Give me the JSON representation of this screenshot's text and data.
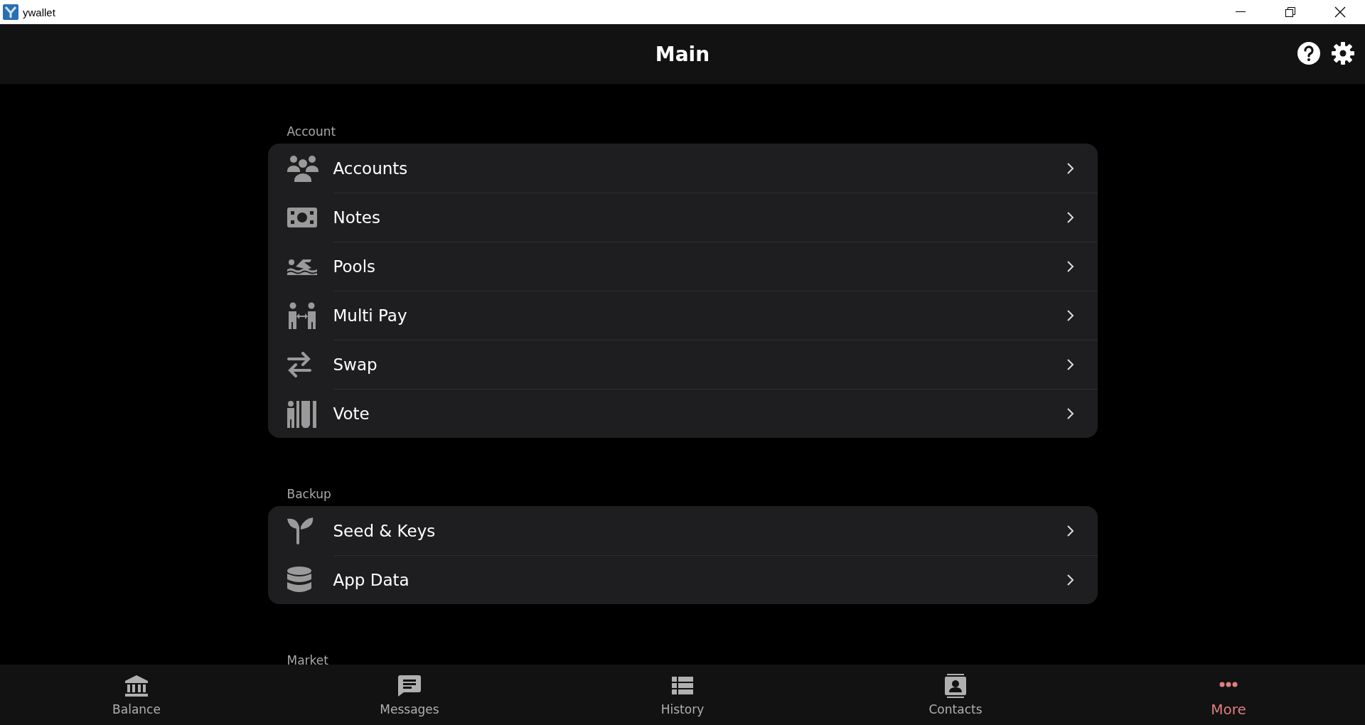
{
  "window": {
    "title": "ywallet"
  },
  "app_bar": {
    "title": "Main"
  },
  "sections": [
    {
      "label": "Account",
      "items": [
        {
          "label": "Accounts"
        },
        {
          "label": "Notes"
        },
        {
          "label": "Pools"
        },
        {
          "label": "Multi Pay"
        },
        {
          "label": "Swap"
        },
        {
          "label": "Vote"
        }
      ]
    },
    {
      "label": "Backup",
      "items": [
        {
          "label": "Seed & Keys"
        },
        {
          "label": "App Data"
        }
      ]
    },
    {
      "label": "Market"
    }
  ],
  "bottom_nav": [
    {
      "label": "Balance",
      "selected": false
    },
    {
      "label": "Messages",
      "selected": false
    },
    {
      "label": "History",
      "selected": false
    },
    {
      "label": "Contacts",
      "selected": false
    },
    {
      "label": "More",
      "selected": true
    }
  ]
}
